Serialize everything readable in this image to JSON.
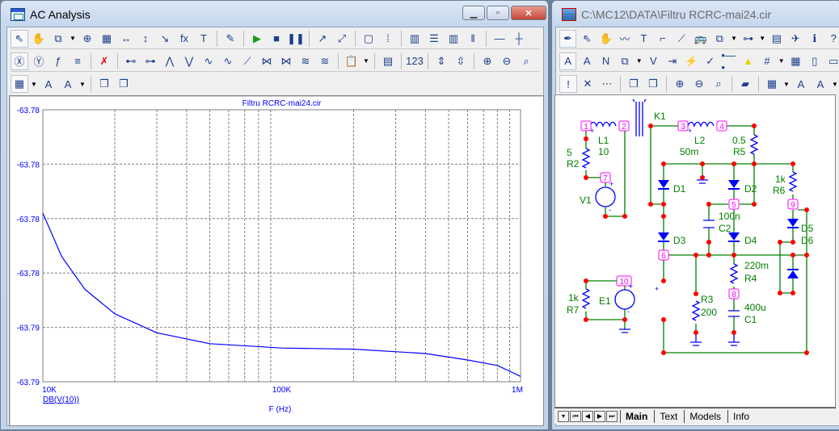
{
  "left_window": {
    "title": "AC Analysis",
    "buttons": {
      "minimize": "▁",
      "maximize": "▫",
      "close": "✕"
    },
    "toolbar_rows": [
      [
        [
          "select-arrow-icon",
          "⇖"
        ],
        [
          "pan-hand-icon",
          "✋"
        ],
        [
          "scale-icon",
          "⧉"
        ],
        [
          "dropdown-icon",
          "▼"
        ],
        [
          "zoom-region-icon",
          "⊕"
        ],
        [
          "grid-data-icon",
          "▦"
        ],
        [
          "scale-x-icon",
          "↔"
        ],
        [
          "scale-y-icon",
          "↕"
        ],
        [
          "slope-icon",
          "↘"
        ],
        [
          "function-icon",
          "fx"
        ],
        [
          "text-icon",
          "T"
        ],
        [
          "sep",
          ""
        ],
        [
          "properties-icon",
          "✎"
        ],
        [
          "sep",
          ""
        ],
        [
          "run-icon",
          "▶"
        ],
        [
          "stop-icon",
          "■"
        ],
        [
          "pause-icon",
          "❚❚"
        ],
        [
          "sep",
          ""
        ],
        [
          "data-points-icon",
          "↗"
        ],
        [
          "tokens-icon",
          "⤢"
        ],
        [
          "sep",
          ""
        ],
        [
          "frame-icon",
          "▢"
        ],
        [
          "grid-icon",
          "⁞"
        ],
        [
          "sep",
          ""
        ],
        [
          "vert-grid-icon",
          "▥"
        ],
        [
          "horiz-grid-icon",
          "☰"
        ],
        [
          "minor-grid-icon",
          "▥"
        ],
        [
          "bold-grid-icon",
          "‖"
        ],
        [
          "sep",
          ""
        ],
        [
          "horiz-axis-icon",
          "—"
        ],
        [
          "cross-grid-icon",
          "┼"
        ]
      ],
      [
        [
          "x-axis-icon",
          "Ⓧ"
        ],
        [
          "y-axis-icon",
          "Ⓨ"
        ],
        [
          "fx-axis-icon",
          "ƒ"
        ],
        [
          "equal-icon",
          "≡"
        ],
        [
          "sep",
          ""
        ],
        [
          "remove-curves-icon",
          "✗"
        ],
        [
          "sep",
          ""
        ],
        [
          "cursor-next-icon",
          "⊷"
        ],
        [
          "cursor-prev-icon",
          "⊶"
        ],
        [
          "peak-icon",
          "⋀"
        ],
        [
          "valley-icon",
          "⋁"
        ],
        [
          "high-icon",
          "∿"
        ],
        [
          "low-icon",
          "∿"
        ],
        [
          "slope-cursor-icon",
          "⟋"
        ],
        [
          "min-icon",
          "⋈"
        ],
        [
          "max-icon",
          "⋈"
        ],
        [
          "inflection-icon",
          "≋"
        ],
        [
          "global-icon",
          "≋"
        ],
        [
          "sep",
          ""
        ],
        [
          "tag-icon",
          "📋"
        ],
        [
          "dropdown-icon",
          "▼"
        ],
        [
          "sep",
          ""
        ],
        [
          "text-list-icon",
          "▤"
        ],
        [
          "sep",
          ""
        ],
        [
          "numeric-icon",
          "123"
        ],
        [
          "sep",
          ""
        ],
        [
          "auto-scale-icon",
          "⇕"
        ],
        [
          "restore-scale-icon",
          "⇳"
        ],
        [
          "sep",
          ""
        ],
        [
          "zoom-in-icon",
          "⊕"
        ],
        [
          "zoom-out-icon",
          "⊖"
        ],
        [
          "zoom-100-icon",
          "⌕"
        ]
      ],
      [
        [
          "tile-icon",
          "▦"
        ],
        [
          "dropdown-icon",
          "▼"
        ],
        [
          "font-icon",
          "A"
        ],
        [
          "font-color-icon",
          "A"
        ],
        [
          "dropdown-icon",
          "▼"
        ],
        [
          "sep",
          ""
        ],
        [
          "front-icon",
          "❐"
        ],
        [
          "back-icon",
          "❐"
        ]
      ]
    ]
  },
  "chart_data": {
    "type": "line",
    "title": "Filtru RCRC-mai24.cir",
    "xlabel": "F (Hz)",
    "ylabel": "",
    "xscale": "log",
    "xlim": [
      10000,
      1000000
    ],
    "ylim": [
      -63.7865,
      -63.7815
    ],
    "x_tick_labels": [
      "10K",
      "100K",
      "1M"
    ],
    "y_tick_labels": [
      "-63.78",
      "-63.78",
      "-63.78",
      "-63.78",
      "-63.79",
      "-63.79"
    ],
    "grid": true,
    "series": [
      {
        "name": "DB(V(10))",
        "color": "#0000ff",
        "x": [
          10000,
          12000,
          15000,
          20000,
          30000,
          50000,
          100000,
          200000,
          400000,
          600000,
          800000,
          1000000
        ],
        "y": [
          -63.7834,
          -63.7842,
          -63.7848,
          -63.78525,
          -63.7856,
          -63.7858,
          -63.78588,
          -63.7859,
          -63.78598,
          -63.7861,
          -63.7862,
          -63.7864
        ]
      }
    ]
  },
  "right_window": {
    "title": "C:\\MC12\\DATA\\Filtru RCRC-mai24.cir",
    "toolbar_rows": [
      [
        [
          "component-mode-icon",
          "✒"
        ],
        [
          "select-arrow-icon",
          "⇖"
        ],
        [
          "pan-hand-icon",
          "✋"
        ],
        [
          "wire-icon",
          "〰"
        ],
        [
          "text-icon",
          "T"
        ],
        [
          "wire-mode-icon",
          "⌐"
        ],
        [
          "diagonal-wire-icon",
          "⟋"
        ],
        [
          "bus-icon",
          "🚌"
        ],
        [
          "scale-icon",
          "⧉"
        ],
        [
          "dropdown-icon",
          "▼"
        ],
        [
          "flowchart-icon",
          "⊶"
        ],
        [
          "dropdown-icon",
          "▼"
        ],
        [
          "table-icon",
          "▤"
        ],
        [
          "probe-icon",
          "✈"
        ],
        [
          "info-icon",
          "ℹ"
        ],
        [
          "help-icon",
          "?"
        ]
      ],
      [
        [
          "attribute-text-icon",
          "A"
        ],
        [
          "grid-text-icon",
          "A"
        ],
        [
          "node-numbers-icon",
          "N"
        ],
        [
          "copy-icon",
          "⧉"
        ],
        [
          "dropdown-icon",
          "▼"
        ],
        [
          "voltage-icon",
          "V"
        ],
        [
          "current-icon",
          "⇥"
        ],
        [
          "power-icon",
          "⚡"
        ],
        [
          "condition-icon",
          "✓"
        ],
        [
          "pin-connections-icon",
          "•—•"
        ],
        [
          "warning-icon",
          "▲"
        ],
        [
          "grid-dots-icon",
          "#"
        ],
        [
          "dropdown-icon",
          "▼"
        ],
        [
          "border-icon",
          "▦"
        ],
        [
          "page-icon",
          "▯"
        ],
        [
          "title-icon",
          "▭"
        ]
      ],
      [
        [
          "exclamation-icon",
          "!"
        ],
        [
          "cancel-icon",
          "✕"
        ],
        [
          "more-icon",
          "⋯"
        ],
        [
          "sep",
          ""
        ],
        [
          "front-icon",
          "❐"
        ],
        [
          "back-icon",
          "❐"
        ],
        [
          "sep",
          ""
        ],
        [
          "zoom-in-icon",
          "⊕"
        ],
        [
          "zoom-out-icon",
          "⊖"
        ],
        [
          "zoom-100-icon",
          "⌕"
        ],
        [
          "sep",
          ""
        ],
        [
          "folder-icon",
          "▰"
        ],
        [
          "sep",
          ""
        ],
        [
          "tile-icon",
          "▦"
        ],
        [
          "dropdown-icon",
          "▼"
        ],
        [
          "font-icon",
          "A"
        ],
        [
          "font-color-icon",
          "A"
        ],
        [
          "dropdown-icon",
          "▼"
        ]
      ]
    ],
    "tabs": [
      "Main",
      "Text",
      "Models",
      "Info"
    ],
    "active_tab": "Main",
    "nav_buttons": [
      "▾",
      "⏮",
      "◀",
      "▶",
      "⏭"
    ]
  },
  "schematic": {
    "nodes": [
      "1",
      "2",
      "3",
      "4",
      "5",
      "6",
      "7",
      "8",
      "9",
      "10"
    ],
    "labels": {
      "K1": "K1",
      "L1": "L1",
      "L1v": "10",
      "L2": "L2",
      "L2v": "50m",
      "R2v": "5",
      "R2": "R2",
      "R5v": "0.5",
      "R5": "R5",
      "V1": "V1",
      "D1": "D1",
      "D2": "D2",
      "D3": "D3",
      "D4": "D4",
      "D5": "D5",
      "D6": "D6",
      "C2v": "100n",
      "C2": "C2",
      "R6v": "1k",
      "R6": "R6",
      "R4v": "220m",
      "R4": "R4",
      "C1v": "400u",
      "C1": "C1",
      "R3": "R3",
      "R3v": "200",
      "R7v": "1k",
      "R7": "R7",
      "E1": "E1"
    },
    "colors": {
      "wire": "#008000",
      "component": "#0000ff",
      "node_dot": "#ff0000",
      "node_label": "#ff00ff",
      "text": "#008000"
    }
  }
}
